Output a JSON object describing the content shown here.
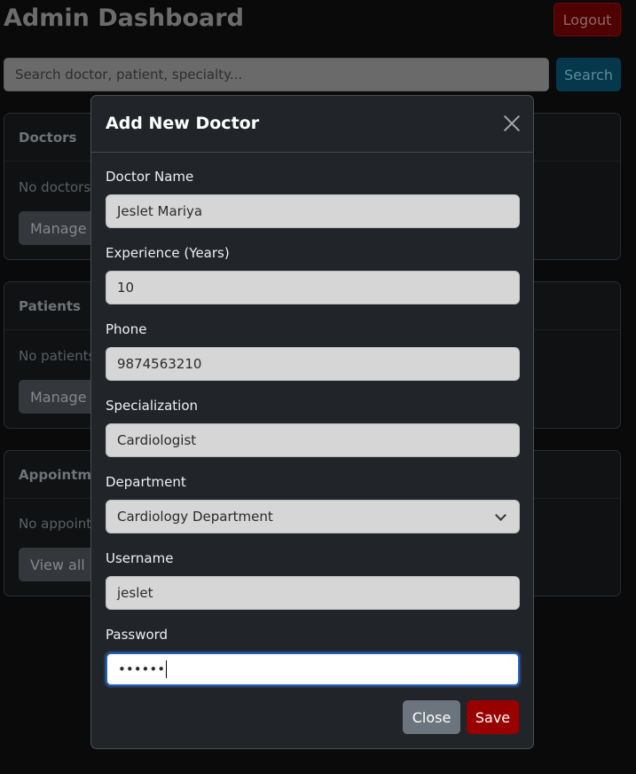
{
  "page": {
    "title": "Admin Dashboard",
    "logout_label": "Logout",
    "search": {
      "placeholder": "Search doctor, patient, specialty...",
      "button_label": "Search"
    },
    "cards": [
      {
        "header": "Doctors",
        "empty_text": "No doctors",
        "button_label": "Manage a"
      },
      {
        "header": "Patients",
        "empty_text": "No patients",
        "button_label": "Manage a"
      },
      {
        "header": "Appointme",
        "empty_text": "No appoint",
        "button_label": "View all"
      }
    ]
  },
  "modal": {
    "title": "Add New Doctor",
    "fields": {
      "doctor_name": {
        "label": "Doctor Name",
        "value": "Jeslet Mariya"
      },
      "experience": {
        "label": "Experience (Years)",
        "value": "10"
      },
      "phone": {
        "label": "Phone",
        "value": "9874563210"
      },
      "specialization": {
        "label": "Specialization",
        "value": "Cardiologist"
      },
      "department": {
        "label": "Department",
        "value": "Cardiology Department"
      },
      "username": {
        "label": "Username",
        "value": "jeslet"
      },
      "password": {
        "label": "Password",
        "value": "••••••"
      }
    },
    "close_label": "Close",
    "save_label": "Save"
  },
  "icons": {
    "close": "close-icon",
    "dropdown": "chevron-down-icon"
  },
  "colors": {
    "save": "#990000",
    "close": "#6c757d",
    "focus": "#2a5fb8",
    "logout": "#4f0000",
    "search": "#05384a"
  }
}
